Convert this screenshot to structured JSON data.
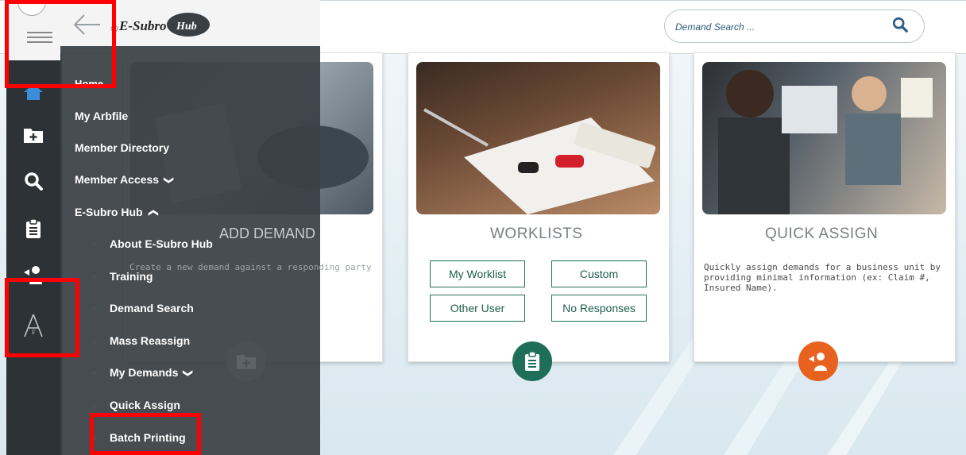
{
  "app": {
    "logo_text": "E-SubroHub"
  },
  "search": {
    "placeholder": "Demand Search ..."
  },
  "menu": {
    "items": [
      {
        "label": "Home"
      },
      {
        "label": "My Arbfile"
      },
      {
        "label": "Member Directory"
      },
      {
        "label": "Member Access"
      },
      {
        "label": "E-Subro Hub"
      }
    ],
    "sub_items": [
      {
        "label": "About E-Subro Hub"
      },
      {
        "label": "Training"
      },
      {
        "label": "Demand Search"
      },
      {
        "label": "Mass Reassign"
      },
      {
        "label": "My Demands"
      },
      {
        "label": "Quick Assign"
      },
      {
        "label": "Batch Printing"
      }
    ],
    "chevron_down": "❯",
    "chevron_up": "❯"
  },
  "cards": {
    "add_demand": {
      "title": "ADD DEMAND",
      "desc": "Create a new demand against a responding party"
    },
    "worklists": {
      "title": "WORKLISTS",
      "buttons": [
        "My Worklist",
        "Custom",
        "Other User",
        "No Responses"
      ]
    },
    "quick_assign": {
      "title": "QUICK ASSIGN",
      "desc": "Quickly assign demands for a business unit by providing minimal information (ex: Claim #, Insured Name)."
    }
  },
  "colors": {
    "accent_green": "#1f6e5a",
    "accent_orange": "#e8621f",
    "highlight_red": "#ff0000"
  }
}
